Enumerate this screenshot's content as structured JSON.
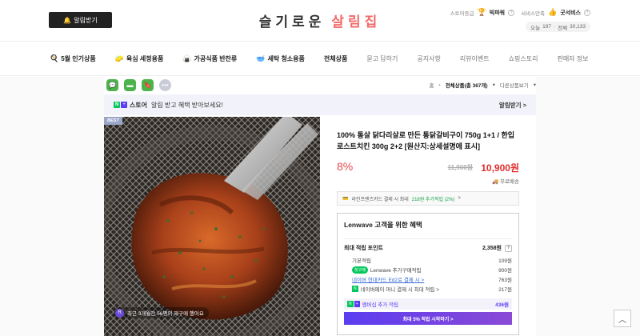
{
  "header": {
    "alarm_button": "알림받기",
    "logo_part1": "슬기로운",
    "logo_part2": "살림집",
    "grade_label": "스토어등급",
    "grade_value": "빅파워",
    "service_label": "서비스만족",
    "service_value": "굿서비스",
    "visit_today_label": "오늘",
    "visit_today": "197",
    "visit_total_label": "전체",
    "visit_total": "30,133"
  },
  "nav": {
    "items": [
      {
        "label": "5월 인기상품",
        "icon": "🍳"
      },
      {
        "label": "육심 세정용품",
        "icon": "🧽"
      },
      {
        "label": "가공식품 반찬류",
        "icon": "🍙"
      },
      {
        "label": "세탁 청소용품",
        "icon": "🥣"
      },
      {
        "label": "전체상품",
        "icon": ""
      },
      {
        "label": "묻고 답하기",
        "icon": ""
      },
      {
        "label": "공지사항",
        "icon": ""
      },
      {
        "label": "리뷰이벤트",
        "icon": ""
      },
      {
        "label": "쇼핑스토리",
        "icon": ""
      },
      {
        "label": "판매자 정보",
        "icon": ""
      }
    ]
  },
  "breadcrumb": {
    "home": "홈",
    "current": "전체상품(총 367개)",
    "next": "다른상품보기"
  },
  "banner": {
    "n_mark": "N",
    "plus_mark": "+",
    "store": "스토어",
    "text": "알림 받고 혜택 받아보세요!",
    "action": "알림받기 >"
  },
  "product": {
    "badge": "BEST",
    "review_icon": "R",
    "review_text": "최근 3개월간 56명이 재구매 했어요",
    "title": "100% 통살 닭다리살로 만든 통닭갈비구이 750g 1+1 / 한입 로스트치킨 300g 2+2 [원산지:상세설명에 표시]",
    "discount": "8%",
    "original_price": "11,900원",
    "price": "10,900원",
    "shipping": "무료배송",
    "card_note_prefix": "라인프렌즈카드 결제 시 최대",
    "card_note_highlight": "218원 추가적립 (2%)",
    "card_note_suffix": ">"
  },
  "benefit": {
    "title": "Lenwave 고객을 위한 혜택",
    "max_label": "최대 적립 포인트",
    "max_value": "2,358원",
    "help": "?",
    "rows": [
      {
        "label": "기본적립",
        "value": "109원",
        "tag": "",
        "blue": false
      },
      {
        "label": "Lenwave 추가구매적립",
        "value": "900원",
        "tag": "pill",
        "tag_text": "첫구매",
        "blue": false
      },
      {
        "label": "네이버 현대카드 Ed2로 결제 시 >",
        "value": "763원",
        "tag": "",
        "blue": true
      },
      {
        "label": "네이버페이 머니 결제 시 최대 적립 >",
        "value": "217원",
        "tag": "nbox",
        "tag_text": "N",
        "blue": false
      }
    ],
    "membership_label": "멤버십 추가 적립",
    "membership_tag1": "N",
    "membership_tag2": "+",
    "membership_value": "436원",
    "cta": "최대 5% 적립 시작하기 >"
  },
  "colors": {
    "accent_green": "#03c75a",
    "accent_purple": "#5b3df0",
    "price_red": "#e02d2d"
  }
}
